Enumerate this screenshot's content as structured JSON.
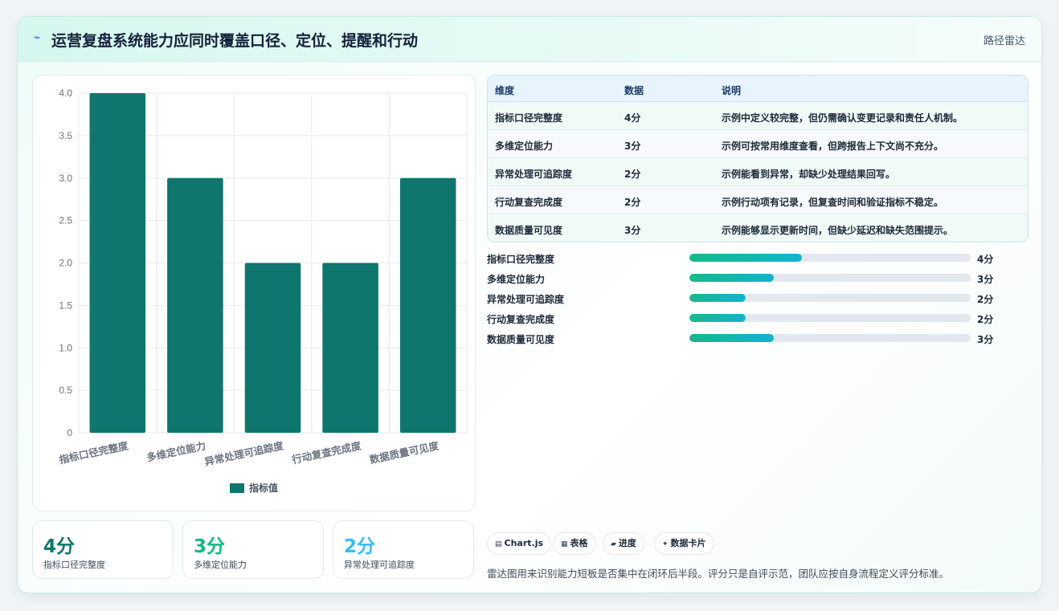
{
  "header": {
    "icon": "bolt-icon",
    "title": "运营复盘系统能力应同时覆盖口径、定位、提醒和行动",
    "tag": "路径雷达"
  },
  "colors": {
    "bar": "#0f766e",
    "kpi": [
      "#0f766e",
      "#10b981",
      "#38bdf8"
    ],
    "progress_start": "#17b88a",
    "progress_end": "#14b2cf"
  },
  "chart_data": {
    "type": "bar",
    "categories": [
      "指标口径完整度",
      "多维定位能力",
      "异常处理可追踪度",
      "行动复查完成度",
      "数据质量可见度"
    ],
    "series": [
      {
        "name": "指标值",
        "values": [
          4,
          3,
          2,
          2,
          3
        ]
      }
    ],
    "yticks": [
      "0",
      "0.5",
      "1.0",
      "1.5",
      "2.0",
      "2.5",
      "3.0",
      "3.5",
      "4.0"
    ],
    "ylim": [
      0,
      4
    ],
    "grid": true,
    "legend": "bottom"
  },
  "table": {
    "headers": [
      "维度",
      "数据",
      "说明"
    ],
    "rows": [
      {
        "dim": "指标口径完整度",
        "score": "4分",
        "desc": "示例中定义较完整，但仍需确认变更记录和责任人机制。"
      },
      {
        "dim": "多维定位能力",
        "score": "3分",
        "desc": "示例可按常用维度查看，但跨报告上下文尚不充分。"
      },
      {
        "dim": "异常处理可追踪度",
        "score": "2分",
        "desc": "示例能看到异常，却缺少处理结果回写。"
      },
      {
        "dim": "行动复查完成度",
        "score": "2分",
        "desc": "示例行动项有记录，但复查时间和验证指标不稳定。"
      },
      {
        "dim": "数据质量可见度",
        "score": "3分",
        "desc": "示例能够显示更新时间，但缺少延迟和缺失范围提示。"
      }
    ]
  },
  "progress": {
    "max": 10,
    "items": [
      {
        "label": "指标口径完整度",
        "value": 4,
        "text": "4分"
      },
      {
        "label": "多维定位能力",
        "value": 3,
        "text": "3分"
      },
      {
        "label": "异常处理可追踪度",
        "value": 2,
        "text": "2分"
      },
      {
        "label": "行动复查完成度",
        "value": 2,
        "text": "2分"
      },
      {
        "label": "数据质量可见度",
        "value": 3,
        "text": "3分"
      }
    ]
  },
  "kpis": [
    {
      "value": "4分",
      "label": "指标口径完整度"
    },
    {
      "value": "3分",
      "label": "多维定位能力"
    },
    {
      "value": "2分",
      "label": "异常处理可追踪度"
    }
  ],
  "chips": [
    {
      "icon": "chart-icon",
      "glyph": "▤",
      "label": "Chart.js"
    },
    {
      "icon": "table-icon",
      "glyph": "▦",
      "label": "表格"
    },
    {
      "icon": "progress-icon",
      "glyph": "▰",
      "label": "进度"
    },
    {
      "icon": "card-icon",
      "glyph": "✦",
      "label": "数据卡片"
    }
  ],
  "note": "雷达图用来识别能力短板是否集中在闭环后半段。评分只是自评示范，团队应按自身流程定义评分标准。"
}
